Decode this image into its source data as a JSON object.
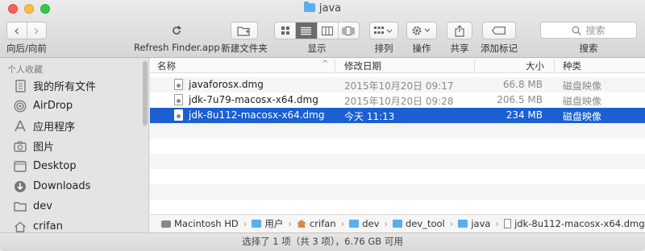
{
  "window": {
    "title": "java"
  },
  "toolbar": {
    "nav_label": "向后/向前",
    "refresh_label": "Refresh Finder.app",
    "new_folder_label": "新建文件夹",
    "view_label": "显示",
    "arrange_label": "排列",
    "action_label": "操作",
    "share_label": "共享",
    "tags_label": "添加标记",
    "search_label": "搜索",
    "search_placeholder": "搜索",
    "back_glyph": "‹",
    "forward_glyph": "›"
  },
  "sidebar": {
    "section": "个人收藏",
    "items": [
      {
        "label": "我的所有文件",
        "icon": "all-files-icon"
      },
      {
        "label": "AirDrop",
        "icon": "airdrop-icon"
      },
      {
        "label": "应用程序",
        "icon": "applications-icon"
      },
      {
        "label": "图片",
        "icon": "camera-icon"
      },
      {
        "label": "Desktop",
        "icon": "desktop-icon"
      },
      {
        "label": "Downloads",
        "icon": "download-icon"
      },
      {
        "label": "dev",
        "icon": "folder-icon"
      },
      {
        "label": "crifan",
        "icon": "home-icon"
      }
    ]
  },
  "columns": {
    "name": "名称",
    "date": "修改日期",
    "size": "大小",
    "kind": "种类",
    "sort_glyph": "^"
  },
  "files": [
    {
      "name": "javaforosx.dmg",
      "date": "2015年10月20日 09:17",
      "size": "66.8 MB",
      "kind": "磁盘映像"
    },
    {
      "name": "jdk-7u79-macosx-x64.dmg",
      "date": "2015年10月20日 09:28",
      "size": "206.5 MB",
      "kind": "磁盘映像"
    },
    {
      "name": "jdk-8u112-macosx-x64.dmg",
      "date": "今天 11:13",
      "size": "234 MB",
      "kind": "磁盘映像"
    }
  ],
  "selected_index": 2,
  "path": [
    {
      "label": "Macintosh HD",
      "icon": "disk"
    },
    {
      "label": "用户",
      "icon": "folder"
    },
    {
      "label": "crifan",
      "icon": "home"
    },
    {
      "label": "dev",
      "icon": "folder"
    },
    {
      "label": "dev_tool",
      "icon": "folder"
    },
    {
      "label": "java",
      "icon": "folder"
    },
    {
      "label": "jdk-8u112-macosx-x64.dmg",
      "icon": "file"
    }
  ],
  "status": "选择了 1 项（共 3 项），6.76 GB 可用"
}
